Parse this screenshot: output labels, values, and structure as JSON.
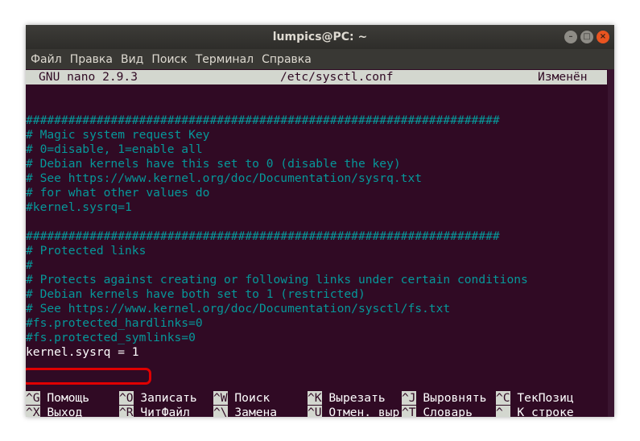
{
  "window": {
    "title": "lumpics@PC: ~"
  },
  "menu": {
    "items": [
      "Файл",
      "Правка",
      "Вид",
      "Поиск",
      "Терминал",
      "Справка"
    ]
  },
  "status": {
    "app": "GNU nano 2.9.3",
    "file": "/etc/sysctl.conf",
    "state": "Изменён"
  },
  "lines": [
    {
      "text": "",
      "type": "comment"
    },
    {
      "text": "",
      "type": "comment"
    },
    {
      "text": "###################################################################",
      "type": "comment"
    },
    {
      "text": "# Magic system request Key",
      "type": "comment"
    },
    {
      "text": "# 0=disable, 1=enable all",
      "type": "comment"
    },
    {
      "text": "# Debian kernels have this set to 0 (disable the key)",
      "type": "comment"
    },
    {
      "text": "# See https://www.kernel.org/doc/Documentation/sysrq.txt",
      "type": "comment"
    },
    {
      "text": "# for what other values do",
      "type": "comment"
    },
    {
      "text": "#kernel.sysrq=1",
      "type": "comment"
    },
    {
      "text": "",
      "type": "comment"
    },
    {
      "text": "###################################################################",
      "type": "comment"
    },
    {
      "text": "# Protected links",
      "type": "comment"
    },
    {
      "text": "#",
      "type": "comment"
    },
    {
      "text": "# Protects against creating or following links under certain conditions",
      "type": "comment"
    },
    {
      "text": "# Debian kernels have both set to 1 (restricted)",
      "type": "comment"
    },
    {
      "text": "# See https://www.kernel.org/doc/Documentation/sysctl/fs.txt",
      "type": "comment"
    },
    {
      "text": "#fs.protected_hardlinks=0",
      "type": "comment"
    },
    {
      "text": "#fs.protected_symlinks=0",
      "type": "comment"
    },
    {
      "text": "kernel.sysrq = 1",
      "type": "plain"
    }
  ],
  "shortcuts": {
    "row1": [
      {
        "key": "^G",
        "label": "Помощь"
      },
      {
        "key": "^O",
        "label": "Записать"
      },
      {
        "key": "^W",
        "label": "Поиск"
      },
      {
        "key": "^K",
        "label": "Вырезать"
      },
      {
        "key": "^J",
        "label": "Выровнять"
      },
      {
        "key": "^C",
        "label": "ТекПозиц"
      }
    ],
    "row2": [
      {
        "key": "^X",
        "label": "Выход"
      },
      {
        "key": "^R",
        "label": "ЧитФайл"
      },
      {
        "key": "^\\",
        "label": "Замена"
      },
      {
        "key": "^U",
        "label": "Отмен. выр"
      },
      {
        "key": "^T",
        "label": "Словарь"
      },
      {
        "key": "^_",
        "label": "К строке"
      }
    ]
  },
  "colors": {
    "terminal_bg": "#300a24",
    "comment": "#06989a",
    "highlight_border": "#e00000"
  }
}
